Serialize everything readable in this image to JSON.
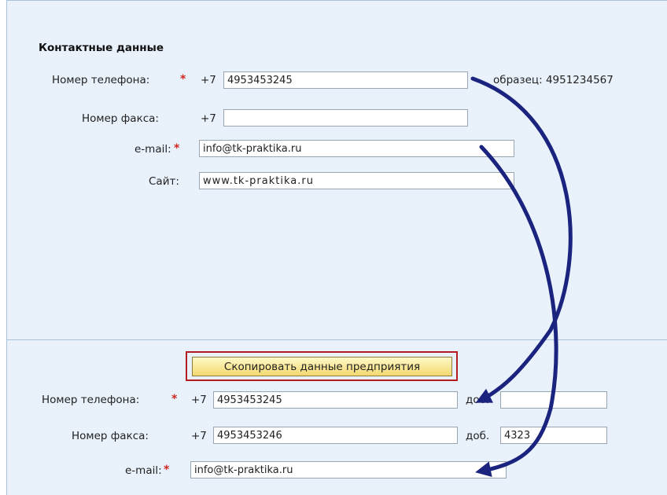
{
  "top": {
    "section_title": "Контактные данные",
    "phone": {
      "label": "Номер телефона:",
      "required": "*",
      "prefix": "+7",
      "value": "4953453245",
      "hint": "образец: 4951234567"
    },
    "fax": {
      "label": "Номер факса:",
      "prefix": "+7",
      "value": ""
    },
    "email": {
      "label": "e-mail:",
      "required": "*",
      "value": "info@tk-praktika.ru"
    },
    "site": {
      "label": "Сайт:",
      "value": "www.tk-praktika.ru"
    }
  },
  "bottom": {
    "copy_button": "Скопировать данные предприятия",
    "phone": {
      "label": "Номер телефона:",
      "required": "*",
      "prefix": "+7",
      "value": "4953453245",
      "ext_label": "доб.",
      "ext_value": ""
    },
    "fax": {
      "label": "Номер факса:",
      "prefix": "+7",
      "value": "4953453246",
      "ext_label": "доб.",
      "ext_value": "4323"
    },
    "email": {
      "label": "e-mail:",
      "required": "*",
      "value": "info@tk-praktika.ru"
    }
  },
  "colors": {
    "panel_bg": "#e9f1fb",
    "required": "#d0271d",
    "highlight_frame": "#b31c20",
    "arrow": "#1a237e"
  }
}
